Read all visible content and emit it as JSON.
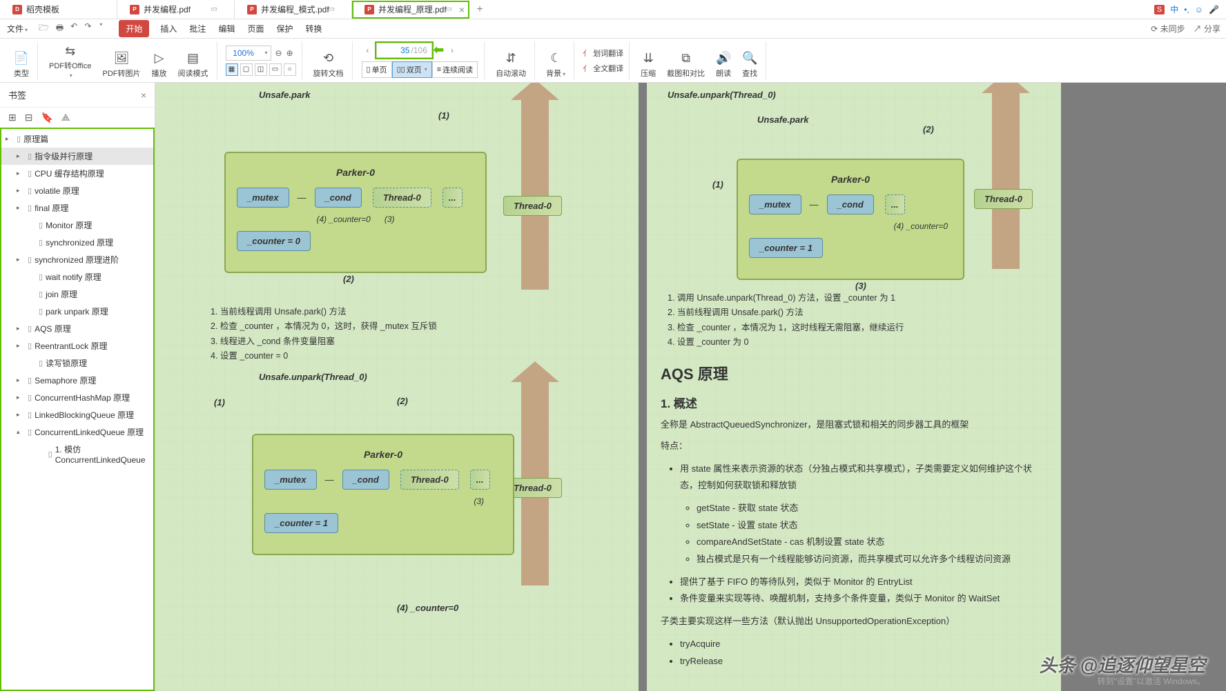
{
  "tabs": [
    {
      "label": "稻壳模板",
      "icon": "app"
    },
    {
      "label": "并发编程.pdf",
      "icon": "pdf"
    },
    {
      "label": "并发编程_模式.pdf",
      "icon": "pdf"
    },
    {
      "label": "并发编程_原理.pdf",
      "icon": "pdf",
      "active": true
    }
  ],
  "ime": {
    "badge": "S",
    "text": "中"
  },
  "menubar": {
    "left_icons": [
      "folder",
      "open",
      "print",
      "undo",
      "redo"
    ],
    "file_label": "文件",
    "items": [
      "开始",
      "插入",
      "批注",
      "编辑",
      "页面",
      "保护",
      "转换"
    ],
    "active_index": 0,
    "right": {
      "sync": "未同步",
      "share": "分享"
    }
  },
  "toolbar": {
    "pdf_to_office": "PDF转Office",
    "pdf_to_image": "PDF转图片",
    "pdf_type": "PDF",
    "type": "类型",
    "play": "播放",
    "read_mode": "阅读模式",
    "zoom": "100%",
    "rotate": "旋转文档",
    "single_page": "单页",
    "double_page": "双页",
    "continuous": "连续阅读",
    "page_current": "35",
    "page_total": "/106",
    "auto_scroll": "自动滚动",
    "background": "背景",
    "word_translate": "划词翻译",
    "full_translate": "全文翻译",
    "compress": "压缩",
    "screenshot_compare": "截图和对比",
    "read_aloud": "朗读",
    "find": "查找"
  },
  "sidebar": {
    "title": "书签",
    "bookmarks": [
      {
        "label": "原理篇",
        "level": 1,
        "expanded": true
      },
      {
        "label": "指令级并行原理",
        "level": 2,
        "expanded": true,
        "selected": true
      },
      {
        "label": "CPU 缓存结构原理",
        "level": 2,
        "expanded": true
      },
      {
        "label": "volatile 原理",
        "level": 2,
        "expanded": true
      },
      {
        "label": "final 原理",
        "level": 2,
        "expanded": true
      },
      {
        "label": "Monitor 原理",
        "level": 3
      },
      {
        "label": "synchronized 原理",
        "level": 3
      },
      {
        "label": "synchronized 原理进阶",
        "level": 2,
        "expanded": true
      },
      {
        "label": "wait notify 原理",
        "level": 3
      },
      {
        "label": "join 原理",
        "level": 3
      },
      {
        "label": "park unpark 原理",
        "level": 3
      },
      {
        "label": "AQS 原理",
        "level": 2,
        "expanded": true
      },
      {
        "label": "ReentrantLock 原理",
        "level": 2,
        "expanded": true
      },
      {
        "label": "读写锁原理",
        "level": 3
      },
      {
        "label": "Semaphore 原理",
        "level": 2,
        "expanded": true
      },
      {
        "label": "ConcurrentHashMap 原理",
        "level": 2,
        "expanded": true
      },
      {
        "label": "LinkedBlockingQueue 原理",
        "level": 2,
        "expanded": true
      },
      {
        "label": "ConcurrentLinkedQueue 原理",
        "level": 2,
        "expanded": false,
        "open": true
      },
      {
        "label": "1. 模仿 ConcurrentLinkedQueue",
        "level": 4
      }
    ]
  },
  "doc": {
    "d1": {
      "title_label": "Unsafe.park",
      "parker": "Parker-0",
      "mutex": "_mutex",
      "cond": "_cond",
      "thread0": "Thread-0",
      "dots": "...",
      "counter0": "_counter = 0",
      "counter1": "_counter = 1",
      "edge1": "(1)",
      "edge2": "(2)",
      "edge3": "(3)",
      "edge4_counter0": "(4) _counter=0",
      "thread_ext": "Thread-0"
    },
    "list1": [
      "1. 当前线程调用 Unsafe.park() 方法",
      "2. 检查 _counter ，本情况为 0，这时，获得 _mutex 互斥锁",
      "3. 线程进入 _cond 条件变量阻塞",
      "4. 设置 _counter = 0"
    ],
    "d2_title": "Unsafe.unpark(Thread_0)",
    "list2": [
      "1. 调用 Unsafe.unpark(Thread_0) 方法，设置 _counter 为 1",
      "2. 当前线程调用 Unsafe.park() 方法",
      "3. 检查 _counter ，本情况为 1，这时线程无需阻塞，继续运行",
      "4. 设置 _counter 为 0"
    ],
    "aqs_heading": "AQS 原理",
    "overview_heading": "1. 概述",
    "overview_para": "全称是 AbstractQueuedSynchronizer，是阻塞式锁和相关的同步器工具的框架",
    "features_label": "特点：",
    "features": [
      "用 state 属性来表示资源的状态（分独占模式和共享模式），子类需要定义如何维护这个状态，控制如何获取锁和释放锁"
    ],
    "sub_features": [
      "getState - 获取 state 状态",
      "setState - 设置 state 状态",
      "compareAndSetState - cas 机制设置 state 状态",
      "独占模式是只有一个线程能够访问资源，而共享模式可以允许多个线程访问资源"
    ],
    "features2": [
      "提供了基于 FIFO 的等待队列，类似于 Monitor 的 EntryList",
      "条件变量来实现等待、唤醒机制，支持多个条件变量，类似于 Monitor 的 WaitSet"
    ],
    "subclass_para": "子类主要实现这样一些方法（默认抛出 UnsupportedOperationException）",
    "subclass_methods": [
      "tryAcquire",
      "tryRelease"
    ]
  },
  "watermark": "头条 @追逐仰望星空",
  "activate": {
    "l1": "激活 Windows",
    "l2": "转到\"设置\"以激活 Windows。"
  }
}
